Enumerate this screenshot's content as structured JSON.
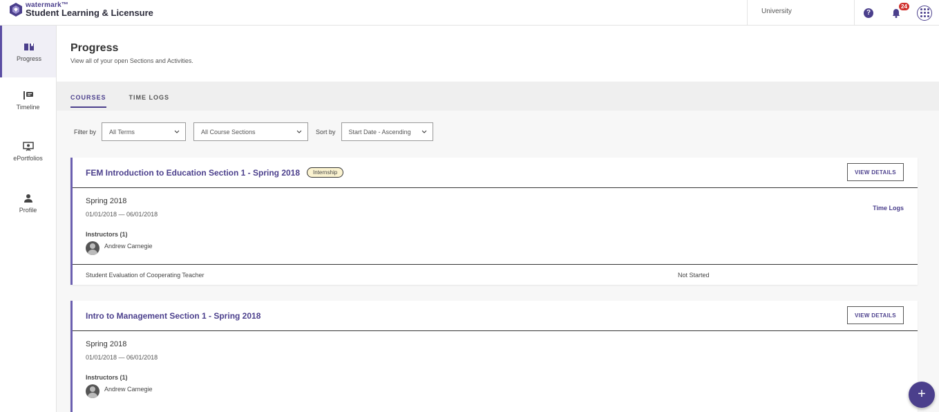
{
  "app": {
    "brand_small": "watermark™",
    "brand_main": "Student Learning & Licensure"
  },
  "topbar": {
    "institution": "University",
    "help_label": "?",
    "notification_count": "24"
  },
  "sidebar": {
    "items": [
      {
        "label": "Progress",
        "icon": "book-icon",
        "active": true
      },
      {
        "label": "Timeline",
        "icon": "timeline-icon",
        "active": false
      },
      {
        "label": "ePortfolios",
        "icon": "presentation-icon",
        "active": false
      },
      {
        "label": "Profile",
        "icon": "person-icon",
        "active": false
      }
    ]
  },
  "page": {
    "title": "Progress",
    "subtitle": "View all of your open Sections and Activities."
  },
  "tabs": [
    {
      "label": "COURSES",
      "active": true
    },
    {
      "label": "TIME LOGS",
      "active": false
    }
  ],
  "filters": {
    "filter_label": "Filter by",
    "term": "All Terms",
    "section": "All Course Sections",
    "sort_label": "Sort by",
    "sort": "Start Date - Ascending"
  },
  "courses": [
    {
      "title": "FEM Introduction to Education Section 1 - Spring 2018",
      "tag": "Internship",
      "view_label": "VIEW DETAILS",
      "term": "Spring 2018",
      "dates": "01/01/2018 — 06/01/2018",
      "instructors_label": "Instructors (1)",
      "instructor": "Andrew Carnegie",
      "time_logs_label": "Time Logs",
      "activities": [
        {
          "name": "Student Evaluation of Cooperating Teacher",
          "status": "Not Started"
        }
      ]
    },
    {
      "title": "Intro to Management Section 1 - Spring 2018",
      "view_label": "VIEW DETAILS",
      "term": "Spring 2018",
      "dates": "01/01/2018 — 06/01/2018",
      "instructors_label": "Instructors (1)",
      "instructor": "Andrew Carnegie"
    }
  ],
  "fab": {
    "label": "+"
  },
  "colors": {
    "accent": "#4b3f8c",
    "badge": "#d0312d",
    "tag_bg": "#fbf3d0"
  }
}
